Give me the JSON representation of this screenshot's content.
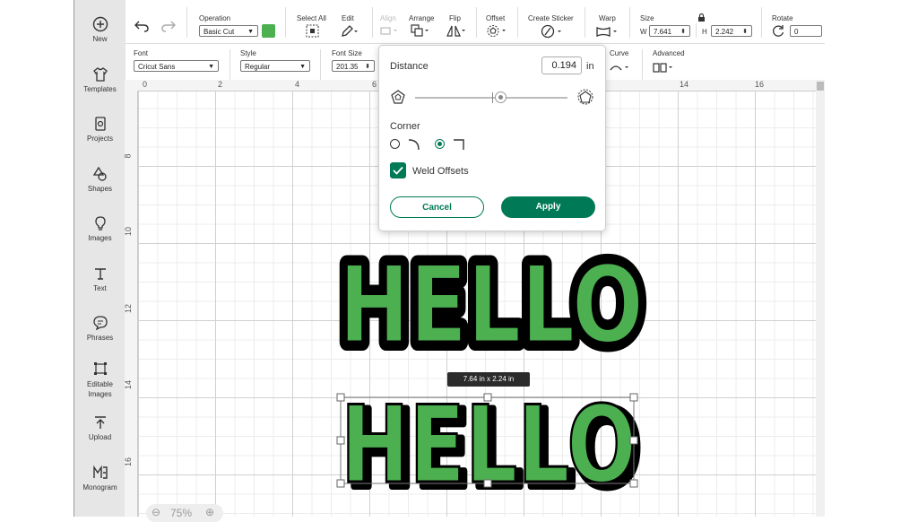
{
  "colors": {
    "accent": "#007a56",
    "swatch": "#4caf50",
    "letter_fill": "#4caf50",
    "outline": "#000000"
  },
  "sidebar": {
    "items": [
      {
        "label": "New",
        "icon": "plus-circle-icon"
      },
      {
        "label": "Templates",
        "icon": "shirt-icon"
      },
      {
        "label": "Projects",
        "icon": "projects-icon"
      },
      {
        "label": "Shapes",
        "icon": "shapes-icon"
      },
      {
        "label": "Images",
        "icon": "lightbulb-icon"
      },
      {
        "label": "Text",
        "icon": "text-icon"
      },
      {
        "label": "Phrases",
        "icon": "speech-bubble-icon"
      },
      {
        "label": "Editable Images",
        "icon": "editable-image-icon"
      },
      {
        "label": "Upload",
        "icon": "upload-icon"
      },
      {
        "label": "Monogram",
        "icon": "monogram-icon"
      }
    ]
  },
  "toolbar": {
    "operation_label": "Operation",
    "operation_value": "Basic Cut",
    "select_all": "Select All",
    "edit": "Edit",
    "align": "Align",
    "arrange": "Arrange",
    "flip": "Flip",
    "offset": "Offset",
    "create_sticker": "Create Sticker",
    "warp": "Warp",
    "size": "Size",
    "w_label": "W",
    "w_value": "7.641",
    "h_label": "H",
    "h_value": "2.242",
    "rotate": "Rotate",
    "rotate_value": "0"
  },
  "fontbar": {
    "font_label": "Font",
    "font_value": "Cricut Sans",
    "style_label": "Style",
    "style_value": "Regular",
    "size_label": "Font Size",
    "size_value": "201.35",
    "curve": "Curve",
    "advanced": "Advanced"
  },
  "ruler": {
    "h": [
      "0",
      "2",
      "4",
      "6",
      "14",
      "16"
    ],
    "v": [
      "8",
      "10",
      "12",
      "14",
      "16"
    ]
  },
  "offset_popup": {
    "distance_label": "Distance",
    "distance_value": "0.194",
    "distance_unit": "in",
    "slider_level": 0.56,
    "corner_label": "Corner",
    "corner_selected": "square",
    "weld_label": "Weld Offsets",
    "weld_checked": true,
    "cancel": "Cancel",
    "apply": "Apply"
  },
  "canvas": {
    "word_top": "HELLO",
    "word_bottom": "HELLO",
    "size_tooltip": "7.64  in x 2.24  in",
    "zoom": "75%"
  }
}
